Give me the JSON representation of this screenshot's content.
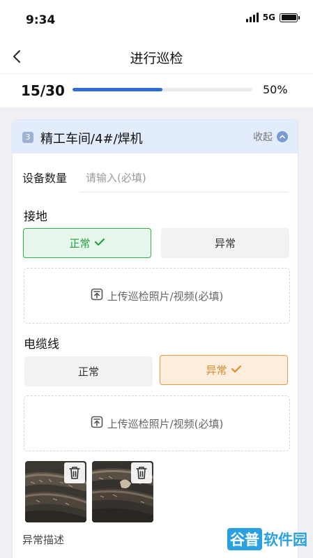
{
  "status_bar": {
    "time": "9:34",
    "network": "5G",
    "icons": [
      "signal-icon",
      "battery-icon"
    ]
  },
  "nav": {
    "title": "进行巡检",
    "back_icon": "chevron-left-icon"
  },
  "progress": {
    "count": "15/30",
    "percent_label": "50%",
    "fraction": 0.5,
    "bar_color": "#2f6ad9"
  },
  "card": {
    "index": "3",
    "title": "精工车间/4#/焊机",
    "collapse_label": "收起",
    "quantity": {
      "label": "设备数量",
      "value": "",
      "placeholder": "请输入(必填)"
    },
    "grounding": {
      "title": "接地",
      "normal_label": "正常",
      "abnormal_label": "异常",
      "selected": "normal",
      "upload_label": "上传巡检照片/视频(必填)"
    },
    "cable": {
      "title": "电缆线",
      "normal_label": "正常",
      "abnormal_label": "异常",
      "selected": "abnormal",
      "upload_label": "上传巡检照片/视频(必填)",
      "photos": [
        "cable-photo-1",
        "cable-photo-2"
      ],
      "description_label": "异常描述"
    }
  },
  "colors": {
    "normal": "#21a23f",
    "abnormal": "#e08a2c",
    "header_bg": "#e3ecfb",
    "accent": "#2f6ad9"
  },
  "watermark": {
    "part1": "谷普",
    "part2": "软件园"
  }
}
